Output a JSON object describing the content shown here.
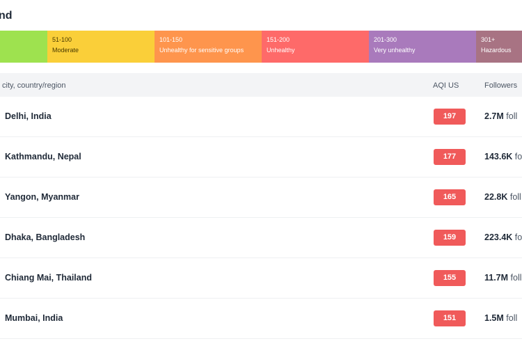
{
  "legend": {
    "title": "nd",
    "segments": [
      {
        "range": "",
        "category": "",
        "color": "#9ee24f"
      },
      {
        "range": "51-100",
        "category": "Moderate",
        "color": "#facf39"
      },
      {
        "range": "101-150",
        "category": "Unhealthy for sensitive groups",
        "color": "#fe954d"
      },
      {
        "range": "151-200",
        "category": "Unhealthy",
        "color": "#fe6a69"
      },
      {
        "range": "201-300",
        "category": "Very unhealthy",
        "color": "#a97abc"
      },
      {
        "range": "301+",
        "category": "Hazardous",
        "color": "#a87383"
      }
    ]
  },
  "table": {
    "columns": {
      "location": "city, country/region",
      "aqi": "AQI US",
      "followers": "Followers"
    },
    "aqi_badge_color": "#f05a5a",
    "rows": [
      {
        "location": "Delhi, India",
        "aqi": "197",
        "followers": "2.7M",
        "followers_word": "foll"
      },
      {
        "location": "Kathmandu, Nepal",
        "aqi": "177",
        "followers": "143.6K",
        "followers_word": "foll"
      },
      {
        "location": "Yangon, Myanmar",
        "aqi": "165",
        "followers": "22.8K",
        "followers_word": "foll"
      },
      {
        "location": "Dhaka, Bangladesh",
        "aqi": "159",
        "followers": "223.4K",
        "followers_word": "foll"
      },
      {
        "location": "Chiang Mai, Thailand",
        "aqi": "155",
        "followers": "11.7M",
        "followers_word": "foll"
      },
      {
        "location": "Mumbai, India",
        "aqi": "151",
        "followers": "1.5M",
        "followers_word": "foll"
      }
    ]
  }
}
